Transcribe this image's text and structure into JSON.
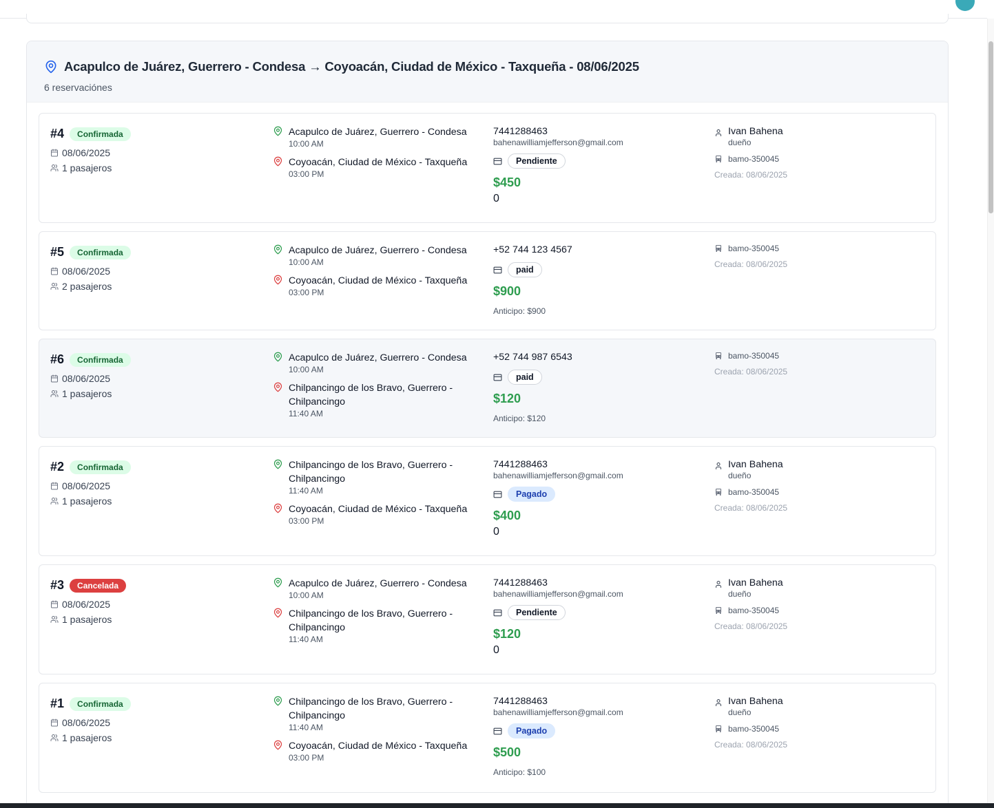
{
  "group": {
    "title": "Acapulco de Juárez, Guerrero - Condesa → Coyoacán, Ciudad de México - Taxqueña - 08/06/2025",
    "count_label": "6 reservaciónes"
  },
  "reservations": [
    {
      "id": "#4",
      "status": "Confirmada",
      "date": "08/06/2025",
      "passengers": "1 pasajeros",
      "origin": "Acapulco de Juárez, Guerrero - Condesa",
      "origin_time": "10:00 AM",
      "destination": "Coyoacán, Ciudad de México - Taxqueña",
      "destination_time": "03:00 PM",
      "phone": "7441288463",
      "email": "bahenawilliamjefferson@gmail.com",
      "payment": "Pendiente",
      "amount": "$450",
      "extra": "0",
      "user_name": "Ivan Bahena",
      "user_role": "dueño",
      "bus": "bamo-350045",
      "created": "Creada: 08/06/2025"
    },
    {
      "id": "#5",
      "status": "Confirmada",
      "date": "08/06/2025",
      "passengers": "2 pasajeros",
      "origin": "Acapulco de Juárez, Guerrero - Condesa",
      "origin_time": "10:00 AM",
      "destination": "Coyoacán, Ciudad de México - Taxqueña",
      "destination_time": "03:00 PM",
      "phone": "+52 744 123 4567",
      "email": "",
      "payment": "paid",
      "amount": "$900",
      "extra": "Anticipo: $900",
      "user_name": "",
      "user_role": "",
      "bus": "bamo-350045",
      "created": "Creada: 08/06/2025"
    },
    {
      "id": "#6",
      "status": "Confirmada",
      "date": "08/06/2025",
      "passengers": "1 pasajeros",
      "origin": "Acapulco de Juárez, Guerrero - Condesa",
      "origin_time": "10:00 AM",
      "destination": "Chilpancingo de los Bravo, Guerrero - Chilpancingo",
      "destination_time": "11:40 AM",
      "phone": "+52 744 987 6543",
      "email": "",
      "payment": "paid",
      "amount": "$120",
      "extra": "Anticipo: $120",
      "user_name": "",
      "user_role": "",
      "bus": "bamo-350045",
      "created": "Creada: 08/06/2025"
    },
    {
      "id": "#2",
      "status": "Confirmada",
      "date": "08/06/2025",
      "passengers": "1 pasajeros",
      "origin": "Chilpancingo de los Bravo, Guerrero - Chilpancingo",
      "origin_time": "11:40 AM",
      "destination": "Coyoacán, Ciudad de México - Taxqueña",
      "destination_time": "03:00 PM",
      "phone": "7441288463",
      "email": "bahenawilliamjefferson@gmail.com",
      "payment": "Pagado",
      "amount": "$400",
      "extra": "0",
      "user_name": "Ivan Bahena",
      "user_role": "dueño",
      "bus": "bamo-350045",
      "created": "Creada: 08/06/2025"
    },
    {
      "id": "#3",
      "status": "Cancelada",
      "date": "08/06/2025",
      "passengers": "1 pasajeros",
      "origin": "Acapulco de Juárez, Guerrero - Condesa",
      "origin_time": "10:00 AM",
      "destination": "Chilpancingo de los Bravo, Guerrero - Chilpancingo",
      "destination_time": "11:40 AM",
      "phone": "7441288463",
      "email": "bahenawilliamjefferson@gmail.com",
      "payment": "Pendiente",
      "amount": "$120",
      "extra": "0",
      "user_name": "Ivan Bahena",
      "user_role": "dueño",
      "bus": "bamo-350045",
      "created": "Creada: 08/06/2025"
    },
    {
      "id": "#1",
      "status": "Confirmada",
      "date": "08/06/2025",
      "passengers": "1 pasajeros",
      "origin": "Chilpancingo de los Bravo, Guerrero - Chilpancingo",
      "origin_time": "11:40 AM",
      "destination": "Coyoacán, Ciudad de México - Taxqueña",
      "destination_time": "03:00 PM",
      "phone": "7441288463",
      "email": "bahenawilliamjefferson@gmail.com",
      "payment": "Pagado",
      "amount": "$500",
      "extra": "Anticipo: $100",
      "user_name": "Ivan Bahena",
      "user_role": "dueño",
      "bus": "bamo-350045",
      "created": "Creada: 08/06/2025"
    }
  ],
  "colors": {
    "origin_pin": "#2e9d4f",
    "destination_pin": "#dc4040",
    "amount": "#2e9d4f",
    "header_pin": "#2563eb"
  },
  "icons": {
    "header": "map-pin-icon",
    "date": "calendar-icon",
    "passengers": "users-icon",
    "origin": "map-pin-icon",
    "destination": "map-pin-icon",
    "payment": "credit-card-icon",
    "user": "user-icon",
    "bus": "bus-icon"
  }
}
